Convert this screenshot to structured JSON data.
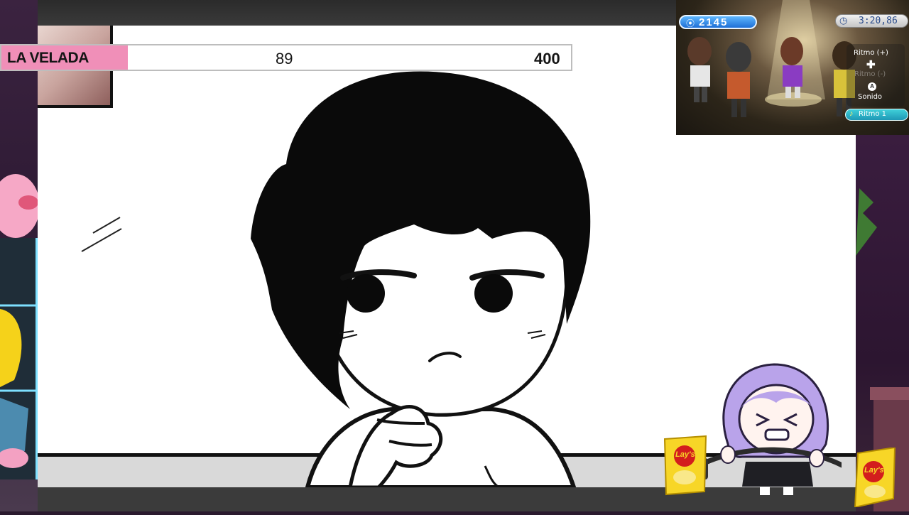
{
  "goal_bar": {
    "label": "LA VELADA",
    "current": "89",
    "target": "400",
    "progress_fraction": 0.2225,
    "fill_color": "#f08fb8"
  },
  "game_overlay": {
    "score": "2145",
    "timer": "3:20,86",
    "menu": {
      "ritmo_plus": "Ritmo (+)",
      "ritmo_minus": "Ritmo (-)",
      "sonido": "Sonido",
      "selected": "Ritmo 1"
    }
  },
  "chips_brand": "Lay's",
  "icons": {
    "score": "footprint-icon",
    "timer": "clock-icon",
    "dpad": "plus-icon",
    "a_button": "a-button-icon",
    "note": "music-note-icon"
  },
  "colors": {
    "comic_bg": "#ffffff",
    "score_pill": "#2a86ee",
    "selected_pill": "#25b2c8",
    "chips_yellow": "#f7d627",
    "chips_red": "#d31d1d"
  }
}
